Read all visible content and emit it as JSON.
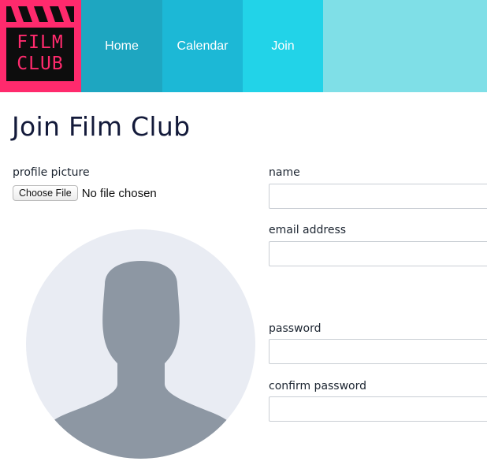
{
  "logo": {
    "line1": "FILM",
    "line2": "CLUB"
  },
  "nav": {
    "home": "Home",
    "calendar": "Calendar",
    "join": "Join"
  },
  "page": {
    "title": "Join Film Club"
  },
  "profile_picture": {
    "label": "profile picture",
    "button": "Choose File",
    "status": "No file chosen"
  },
  "form": {
    "name_label": "name",
    "name_value": "",
    "email_label": "email address",
    "email_value": "",
    "password_label": "password",
    "password_value": "",
    "confirm_password_label": "confirm password",
    "confirm_password_value": ""
  },
  "colors": {
    "brand_pink": "#ff2a6d",
    "nav_home": "#1ea6c1",
    "nav_calendar": "#1cb8d6",
    "nav_join": "#22d3e8",
    "nav_fill": "#7fdfe7",
    "title": "#131a3a"
  },
  "icons": {
    "avatar": "default-user-avatar-icon",
    "logo": "clapperboard-icon"
  }
}
